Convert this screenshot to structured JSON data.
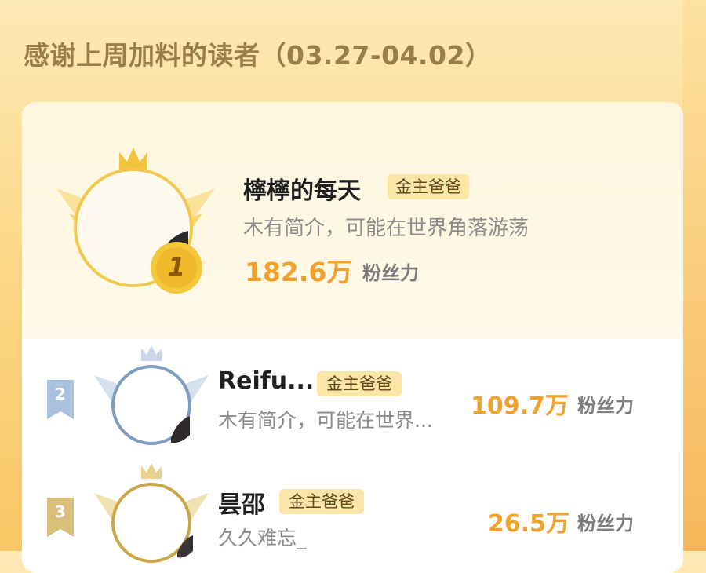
{
  "page": {
    "title": "感谢上周加料的读者（03.27-04.02）"
  },
  "colors": {
    "accent_orange": "#f1a22c",
    "badge_bg": "#fbe6a5",
    "title_brown": "#9b7d49",
    "rank1_gold": "#f2c33b",
    "rank2_blue": "#7f9cc2",
    "rank3_gold": "#c9a64a"
  },
  "readers": [
    {
      "rank": "1",
      "name": "檸檸的每天",
      "badge": "金主爸爸",
      "intro": "木有简介，可能在世界角落游荡",
      "fans_value": "182.6万",
      "fans_unit": "粉丝力",
      "icons": [
        "crown-icon",
        "wings-icon",
        "gold-medal-icon"
      ]
    },
    {
      "rank": "2",
      "name": "Reifu...",
      "badge": "金主爸爸",
      "intro": "木有简介，可能在世界...",
      "fans_value": "109.7万",
      "fans_unit": "粉丝力",
      "icons": [
        "crown-icon",
        "wings-icon",
        "rank-ribbon-icon"
      ]
    },
    {
      "rank": "3",
      "name": "昙邵",
      "badge": "金主爸爸",
      "intro": "久久难忘_",
      "fans_value": "26.5万",
      "fans_unit": "粉丝力",
      "icons": [
        "crown-icon",
        "wings-icon",
        "rank-ribbon-icon"
      ]
    }
  ]
}
